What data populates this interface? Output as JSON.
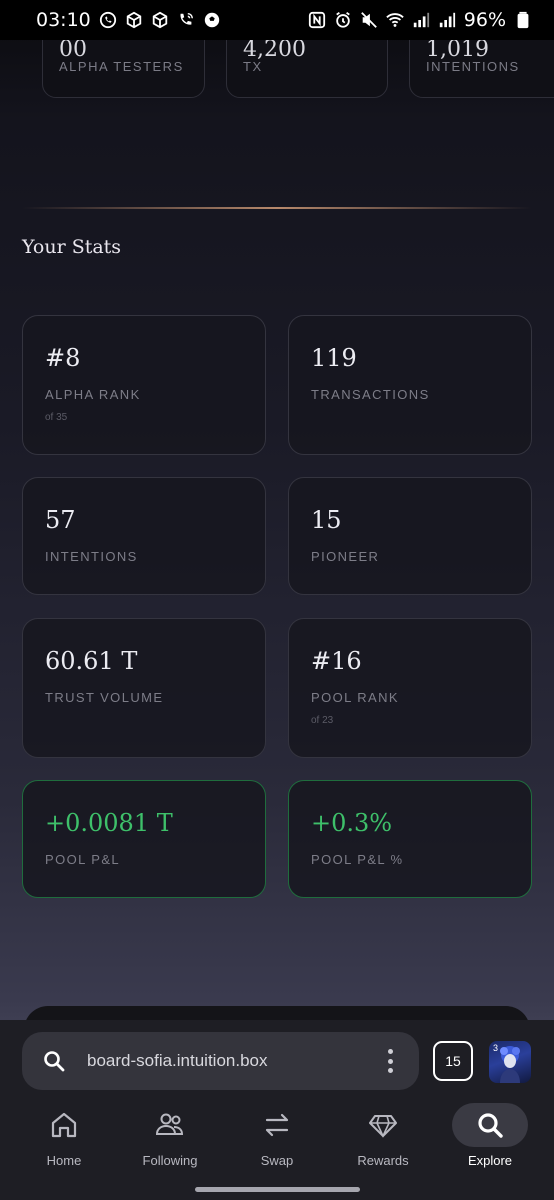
{
  "status_bar": {
    "time": "03:10",
    "battery": "96%",
    "left_icons": [
      "whatsapp-icon",
      "package-icon",
      "package-icon",
      "wifi-call-icon",
      "soccer-ball-icon"
    ],
    "right_icons": [
      "nfc-icon",
      "alarm-icon",
      "mute-icon",
      "wifi-icon",
      "signal-icon",
      "signal-icon",
      "battery-icon"
    ]
  },
  "top_cards": [
    {
      "value": "00",
      "label": "ALPHA TESTERS"
    },
    {
      "value": "4,200",
      "label": "TX"
    },
    {
      "value": "1,019",
      "label": "INTENTIONS"
    }
  ],
  "section_title": "Your Stats",
  "stats": [
    {
      "value": "#8",
      "label": "ALPHA RANK",
      "sub": "of 35"
    },
    {
      "value": "119",
      "label": "TRANSACTIONS",
      "sub": ""
    },
    {
      "value": "57",
      "label": "INTENTIONS",
      "sub": ""
    },
    {
      "value": "15",
      "label": "PIONEER",
      "sub": ""
    },
    {
      "value": "60.61 T",
      "label": "TRUST VOLUME",
      "sub": ""
    },
    {
      "value": "#16",
      "label": "POOL RANK",
      "sub": "of 23"
    },
    {
      "value": "+0.0081 T",
      "label": "POOL P&L",
      "sub": ""
    },
    {
      "value": "+0.3%",
      "label": "POOL P&L %",
      "sub": ""
    }
  ],
  "colors": {
    "positive": "#3ec06a",
    "accent_divider": "#b7896c"
  },
  "browser": {
    "url": "board-sofia.intuition.box",
    "tab_count": "15",
    "avatar_badge": "3"
  },
  "bottom_nav": [
    {
      "label": "Home",
      "icon": "home-icon"
    },
    {
      "label": "Following",
      "icon": "people-icon"
    },
    {
      "label": "Swap",
      "icon": "swap-icon"
    },
    {
      "label": "Rewards",
      "icon": "diamond-icon"
    },
    {
      "label": "Explore",
      "icon": "search-icon",
      "active": true
    }
  ]
}
